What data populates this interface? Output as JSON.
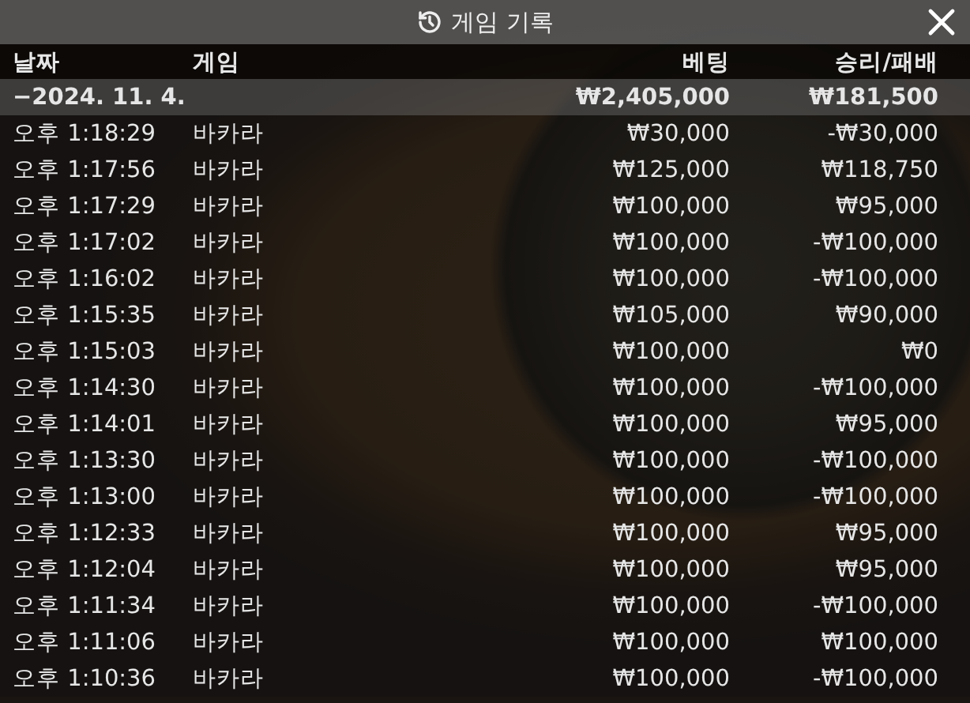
{
  "window": {
    "title": "게임 기록"
  },
  "table": {
    "columns": [
      "날짜",
      "게임",
      "베팅",
      "승리/패배"
    ],
    "summary": {
      "date": "−2024. 11. 4.",
      "bet": "₩2,405,000",
      "result": "₩181,500"
    },
    "rows": [
      {
        "time": "오후 1:18:29",
        "game": "바카라",
        "bet": "₩30,000",
        "result": "-₩30,000"
      },
      {
        "time": "오후 1:17:56",
        "game": "바카라",
        "bet": "₩125,000",
        "result": "₩118,750"
      },
      {
        "time": "오후 1:17:29",
        "game": "바카라",
        "bet": "₩100,000",
        "result": "₩95,000"
      },
      {
        "time": "오후 1:17:02",
        "game": "바카라",
        "bet": "₩100,000",
        "result": "-₩100,000"
      },
      {
        "time": "오후 1:16:02",
        "game": "바카라",
        "bet": "₩100,000",
        "result": "-₩100,000"
      },
      {
        "time": "오후 1:15:35",
        "game": "바카라",
        "bet": "₩105,000",
        "result": "₩90,000"
      },
      {
        "time": "오후 1:15:03",
        "game": "바카라",
        "bet": "₩100,000",
        "result": "₩0"
      },
      {
        "time": "오후 1:14:30",
        "game": "바카라",
        "bet": "₩100,000",
        "result": "-₩100,000"
      },
      {
        "time": "오후 1:14:01",
        "game": "바카라",
        "bet": "₩100,000",
        "result": "₩95,000"
      },
      {
        "time": "오후 1:13:30",
        "game": "바카라",
        "bet": "₩100,000",
        "result": "-₩100,000"
      },
      {
        "time": "오후 1:13:00",
        "game": "바카라",
        "bet": "₩100,000",
        "result": "-₩100,000"
      },
      {
        "time": "오후 1:12:33",
        "game": "바카라",
        "bet": "₩100,000",
        "result": "₩95,000"
      },
      {
        "time": "오후 1:12:04",
        "game": "바카라",
        "bet": "₩100,000",
        "result": "₩95,000"
      },
      {
        "time": "오후 1:11:34",
        "game": "바카라",
        "bet": "₩100,000",
        "result": "-₩100,000"
      },
      {
        "time": "오후 1:11:06",
        "game": "바카라",
        "bet": "₩100,000",
        "result": "₩100,000"
      },
      {
        "time": "오후 1:10:36",
        "game": "바카라",
        "bet": "₩100,000",
        "result": "-₩100,000"
      }
    ]
  }
}
